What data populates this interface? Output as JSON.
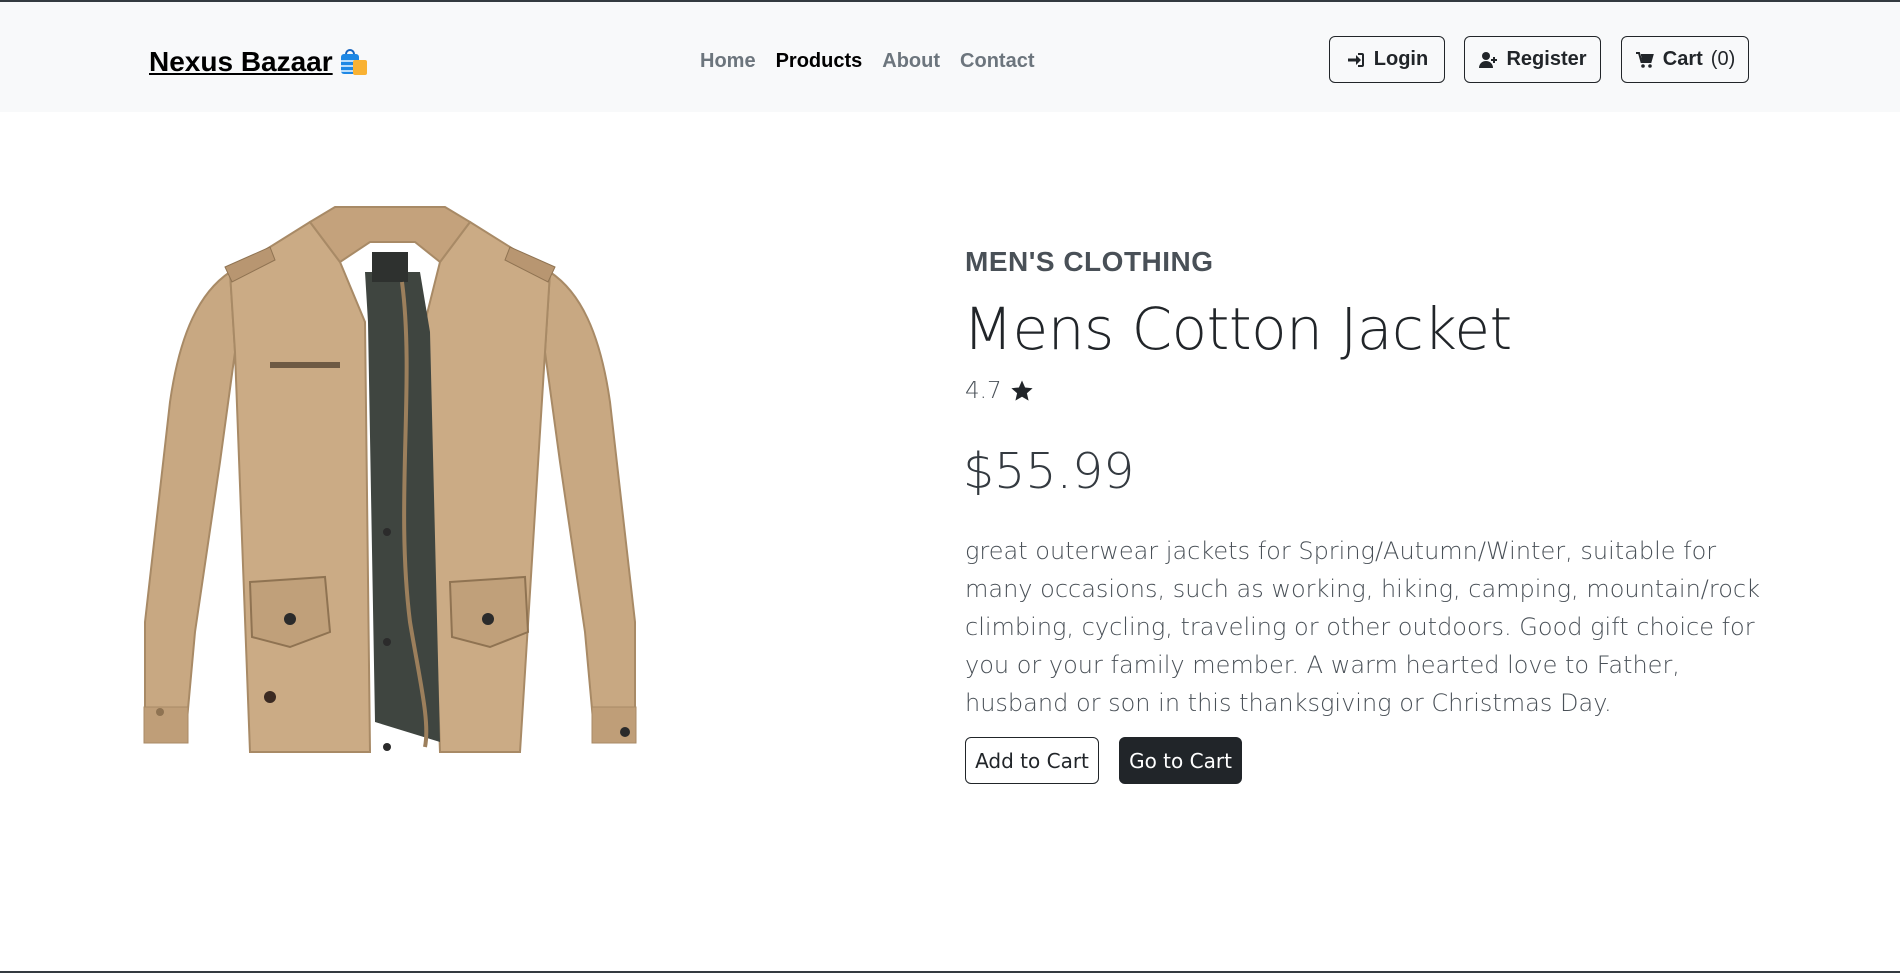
{
  "navbar": {
    "brand": "Nexus Bazaar",
    "brand_icon": "shopping-bags-icon",
    "links": [
      {
        "label": "Home",
        "active": false
      },
      {
        "label": "Products",
        "active": true
      },
      {
        "label": "About",
        "active": false
      },
      {
        "label": "Contact",
        "active": false
      }
    ],
    "login_label": "Login",
    "register_label": "Register",
    "cart_label": "Cart",
    "cart_count": "(0)"
  },
  "product": {
    "category": "MEN'S CLOTHING",
    "title": "Mens Cotton Jacket",
    "rating": "4.7",
    "rating_icon": "star-icon",
    "price": "$55.99",
    "description": "great outerwear jackets for Spring/Autumn/Winter, suitable for many occasions, such as working, hiking, camping, mountain/rock climbing, cycling, traveling or other outdoors. Good gift choice for you or your family member. A warm hearted love to Father, husband or son in this thanksgiving or Christmas Day.",
    "add_to_cart_label": "Add to Cart",
    "go_to_cart_label": "Go to Cart"
  },
  "colors": {
    "navbar_bg": "#f8f9fa",
    "dark": "#212529",
    "muted": "#6c757d",
    "jacket": "#c8a882"
  }
}
